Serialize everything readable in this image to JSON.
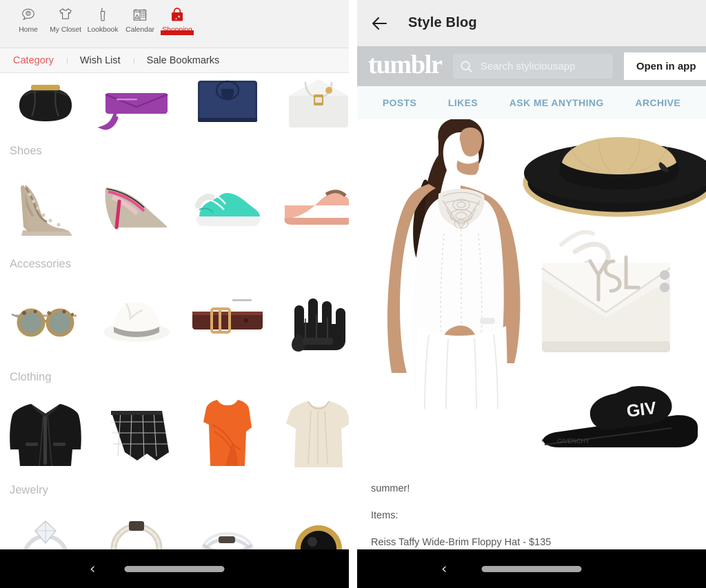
{
  "left_phone": {
    "top_nav": {
      "items": [
        {
          "label": "Home",
          "icon": "home-cloud-icon",
          "active": false
        },
        {
          "label": "My Closet",
          "icon": "tshirt-icon",
          "active": false
        },
        {
          "label": "Lookbook",
          "icon": "hanger-dress-icon",
          "active": false
        },
        {
          "label": "Calendar",
          "icon": "calendar-icon",
          "active": false
        },
        {
          "label": "Shopping",
          "icon": "shopping-bag-icon",
          "active": true
        }
      ],
      "active_color": "#d31510"
    },
    "tabs": [
      {
        "label": "Category",
        "active": true
      },
      {
        "label": "Wish List",
        "active": false
      },
      {
        "label": "Sale Bookmarks",
        "active": false
      }
    ],
    "catalog": {
      "sections": [
        {
          "title": "",
          "items": [
            {
              "name": "black-hobo-handbag"
            },
            {
              "name": "purple-wristlet-wallet"
            },
            {
              "name": "navy-leather-wallet"
            },
            {
              "name": "white-satchel-bag"
            }
          ]
        },
        {
          "title": "Shoes",
          "items": [
            {
              "name": "glitter-strappy-heel"
            },
            {
              "name": "pink-pointed-pump"
            },
            {
              "name": "mint-canvas-sneaker"
            },
            {
              "name": "blush-dorsay-flat"
            }
          ]
        },
        {
          "title": "Accessories",
          "items": [
            {
              "name": "tortoise-sunglasses"
            },
            {
              "name": "white-panama-hat"
            },
            {
              "name": "brown-leather-belt"
            },
            {
              "name": "black-leather-gloves"
            }
          ]
        },
        {
          "title": "Clothing",
          "items": [
            {
              "name": "black-leather-biker-jacket"
            },
            {
              "name": "black-windowpane-skort"
            },
            {
              "name": "orange-ruched-dress"
            },
            {
              "name": "cream-pleated-blouse"
            }
          ]
        },
        {
          "title": "Jewelry",
          "items": [
            {
              "name": "solitaire-diamond-ring"
            },
            {
              "name": "crystal-bangle-bracelet"
            },
            {
              "name": "pave-stacked-ring"
            },
            {
              "name": "black-gold-cocktail-ring"
            }
          ]
        }
      ]
    },
    "system_nav": {
      "back": "‹"
    }
  },
  "right_phone": {
    "app_bar": {
      "title": "Style Blog",
      "back_icon": "arrow-left-icon"
    },
    "tumblr_bar": {
      "logo": "tumblr",
      "search_placeholder": "Search styliciousapp",
      "search_value": "",
      "open_in_app_label": "Open in app",
      "bar_color": "#c9ccce"
    },
    "blog_tabs": [
      {
        "label": "POSTS"
      },
      {
        "label": "LIKES"
      },
      {
        "label": "ASK ME ANYTHING"
      },
      {
        "label": "ARCHIVE"
      }
    ],
    "tab_color": "#7ba7c4",
    "collage": {
      "items": [
        {
          "name": "white-lace-shift-dress-model"
        },
        {
          "name": "black-straw-floppy-hat"
        },
        {
          "name": "white-ysl-crossbody-bag"
        },
        {
          "name": "black-givenchy-slide-sandal"
        }
      ]
    },
    "post": {
      "lines": [
        "summer!",
        "Items:",
        "Reiss Taffy Wide-Brim Floppy Hat - $135"
      ]
    },
    "system_nav": {
      "back": "‹"
    }
  }
}
